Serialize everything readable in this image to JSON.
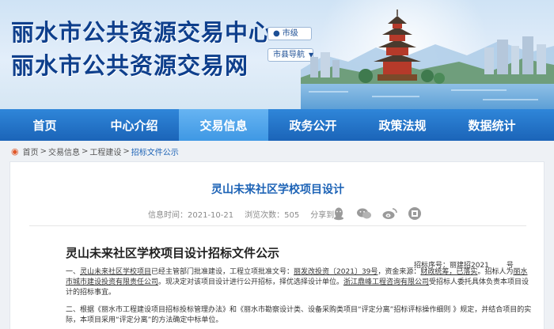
{
  "header": {
    "title_line1": "丽水市公共资源交易中心",
    "title_line2": "丽水市公共资源交易网",
    "city_chip": "市级",
    "nav_chip": "市县导航"
  },
  "nav": {
    "items": [
      {
        "label": "首页",
        "active": false
      },
      {
        "label": "中心介绍",
        "active": false
      },
      {
        "label": "交易信息",
        "active": true
      },
      {
        "label": "政务公开",
        "active": false
      },
      {
        "label": "政策法规",
        "active": false
      },
      {
        "label": "数据统计",
        "active": false
      }
    ]
  },
  "breadcrumb": {
    "items": [
      "首页",
      "交易信息",
      "工程建设",
      "招标文件公示"
    ],
    "separator": ">"
  },
  "article": {
    "title": "灵山未来社区学校项目设计",
    "meta": {
      "date": "信息时间：2021-10-21",
      "views": "浏览次数：505",
      "share_label": "分享到："
    },
    "share_icons": [
      "qq-icon",
      "wechat-icon",
      "weibo-icon",
      "qzone-icon"
    ],
    "heading": "灵山未来社区学校项目设计招标文件公示",
    "doc_number_prefix": "招标序号：丽建招2021",
    "doc_number_suffix": "号",
    "para1_prefix": "一、",
    "para1_project": "灵山未来社区学校项目",
    "para1_a": "已经主管部门批准建设，工程立项批准文号：",
    "para1_approval": "丽发改投资〔2021〕39号",
    "para1_b": "，资金来源：",
    "para1_funding": "财政统筹，已落实",
    "para1_c": "。招标人为",
    "para1_tenderer": "丽水市城市建设投资有限责任公司",
    "para1_d": "。现决定对该项目设计进行公开招标，择优选择设计单位。",
    "para1_agent": "浙江鼎峰工程咨询有限公司",
    "para1_e": "受招标人委托具体负责本项目设计的招标事宜。",
    "para2": "二、根据《丽水市工程建设项目招标投标管理办法》和《丽水市勘察设计类、设备采购类项目“评定分离”招标评标操作细则 》规定，并结合项目的实际，本项目采用“评定分离”的方法确定中标单位。"
  },
  "colors": {
    "brand_blue": "#1b64b8",
    "active_tab": "#3f98e4",
    "title_blue": "#0e3f8c",
    "link_blue": "#1d63b6"
  }
}
